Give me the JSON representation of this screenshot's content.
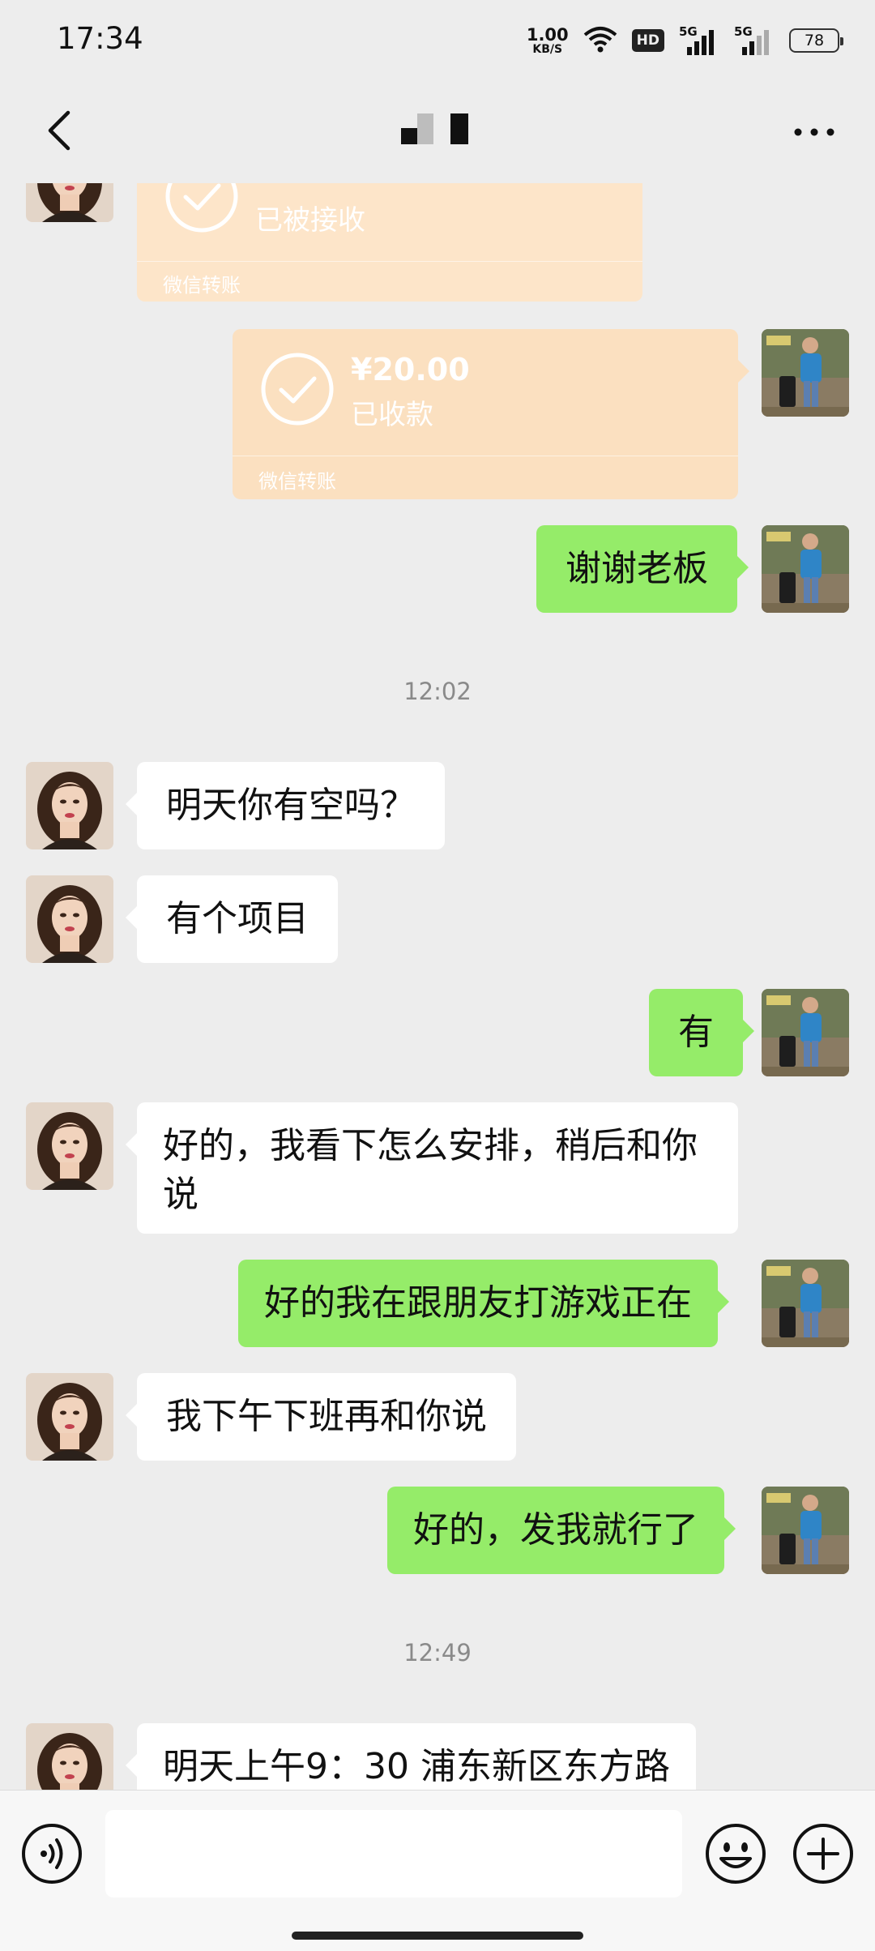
{
  "status_bar": {
    "time": "17:34",
    "net_speed_value": "1.00",
    "net_speed_unit": "KB/S",
    "hd": "HD",
    "sim1": "5G",
    "sim2": "5G",
    "battery": "78"
  },
  "nav": {
    "title": "",
    "back_icon": "chevron-left-icon",
    "more_icon": "more-dots-icon"
  },
  "messages": {
    "transfer_in": {
      "status": "已被接收",
      "footer": "微信转账"
    },
    "transfer_out": {
      "amount": "¥20.00",
      "status": "已收款",
      "footer": "微信转账"
    },
    "m_thanks": "谢谢老板",
    "time_1": "12:02",
    "m_free_tomorrow": "明天你有空吗？",
    "m_project": "有个项目",
    "m_yes": "有",
    "m_arrange": "好的，我看下怎么安排，稍后和你说",
    "m_gaming": "好的我在跟朋友打游戏正在",
    "m_after_work": "我下午下班再和你说",
    "m_send_me": "好的，发我就行了",
    "time_2": "12:49",
    "m_tomorrow_am": "明天上午9：30 浦东新区东方路"
  },
  "input_bar": {
    "placeholder": "",
    "voice_icon": "voice-icon",
    "emoji_icon": "emoji-icon",
    "plus_icon": "plus-icon"
  },
  "colors": {
    "background": "#ededed",
    "incoming_bubble": "#ffffff",
    "outgoing_bubble": "#95ec69",
    "transfer_card": "#fbe0c0"
  }
}
